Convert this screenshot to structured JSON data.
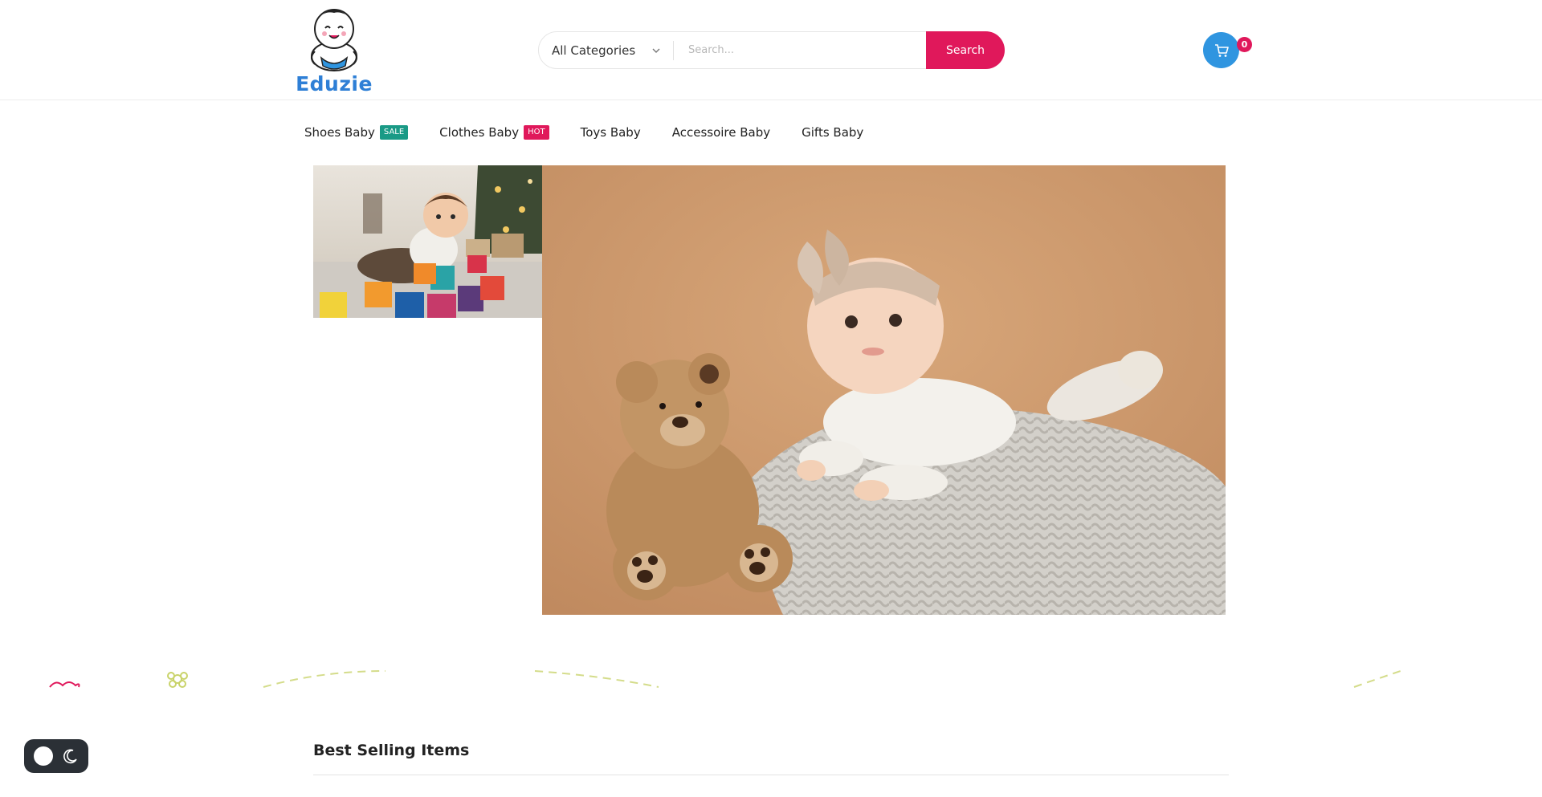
{
  "brand": {
    "name": "Eduzie"
  },
  "search": {
    "category_label": "All Categories",
    "placeholder": "Search...",
    "button_label": "Search"
  },
  "cart": {
    "count": "0"
  },
  "nav": {
    "items": [
      {
        "label": "Shoes Baby",
        "badge": "SALE"
      },
      {
        "label": "Clothes Baby",
        "badge": "HOT"
      },
      {
        "label": "Toys Baby"
      },
      {
        "label": "Accessoire Baby"
      },
      {
        "label": "Gifts Baby"
      }
    ]
  },
  "sections": {
    "best_selling_title": "Best Selling Items"
  },
  "icons": {
    "category_chevron": "chevron-down-icon",
    "cart": "cart-icon",
    "theme_sun": "sun-icon",
    "theme_moon": "moon-icon"
  },
  "colors": {
    "accent": "#e0185b",
    "brand_blue": "#2f95e0",
    "sale_badge": "#1a9a86",
    "toggle_bg": "#2b3036"
  }
}
